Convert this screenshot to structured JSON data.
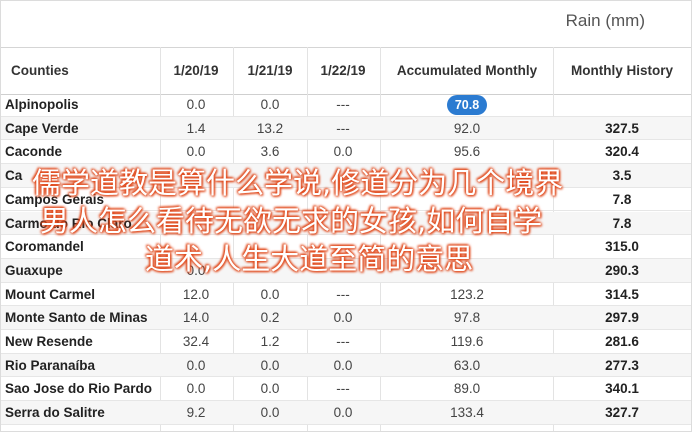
{
  "unit_title": "Rain (mm)",
  "columns": [
    "Counties",
    "1/20/19",
    "1/21/19",
    "1/22/19",
    "Accumulated Monthly",
    "Monthly History"
  ],
  "rows": [
    {
      "county": "Alpinopolis",
      "d1": "0.0",
      "d2": "0.0",
      "d3": "---",
      "acc": "70.8",
      "hist": "",
      "highlight": true
    },
    {
      "county": "Cape Verde",
      "d1": "1.4",
      "d2": "13.2",
      "d3": "---",
      "acc": "92.0",
      "hist": "327.5"
    },
    {
      "county": "Caconde",
      "d1": "0.0",
      "d2": "3.6",
      "d3": "0.0",
      "acc": "95.6",
      "hist": "320.4"
    },
    {
      "county": "Ca",
      "d1": "",
      "d2": "",
      "d3": "",
      "acc": "",
      "hist": "3.5"
    },
    {
      "county": "Campos Gerais",
      "d1": "",
      "d2": "",
      "d3": "",
      "acc": "",
      "hist": "7.8"
    },
    {
      "county": "Carmo do Rio Claro",
      "d1": "",
      "d2": "",
      "d3": "",
      "acc": "",
      "hist": "7.8"
    },
    {
      "county": "Coromandel",
      "d1": "",
      "d2": "",
      "d3": "",
      "acc": "",
      "hist": "315.0"
    },
    {
      "county": "Guaxupe",
      "d1": "0.0",
      "d2": "",
      "d3": "",
      "acc": "",
      "hist": "290.3"
    },
    {
      "county": "Mount Carmel",
      "d1": "12.0",
      "d2": "0.0",
      "d3": "---",
      "acc": "123.2",
      "hist": "314.5"
    },
    {
      "county": "Monte Santo de Minas",
      "d1": "14.0",
      "d2": "0.2",
      "d3": "0.0",
      "acc": "97.8",
      "hist": "297.9"
    },
    {
      "county": "New Resende",
      "d1": "32.4",
      "d2": "1.2",
      "d3": "---",
      "acc": "119.6",
      "hist": "281.6"
    },
    {
      "county": "Rio Paranaíba",
      "d1": "0.0",
      "d2": "0.0",
      "d3": "0.0",
      "acc": "63.0",
      "hist": "277.3"
    },
    {
      "county": "Sao Jose do Rio Pardo",
      "d1": "0.0",
      "d2": "0.0",
      "d3": "---",
      "acc": "89.0",
      "hist": "340.1"
    },
    {
      "county": "Serra do Salitre",
      "d1": "9.2",
      "d2": "0.0",
      "d3": "0.0",
      "acc": "133.4",
      "hist": "327.7"
    }
  ],
  "overlay_lines": [
    "儒学道教是算什么学说,修道分为几个境界",
    "男人怎么看待无欲无求的女孩,如何自学",
    "道术,人生大道至简的意思"
  ],
  "colors": {
    "badge": "#2b7bd1",
    "overlay_stroke": "#e0481a"
  }
}
